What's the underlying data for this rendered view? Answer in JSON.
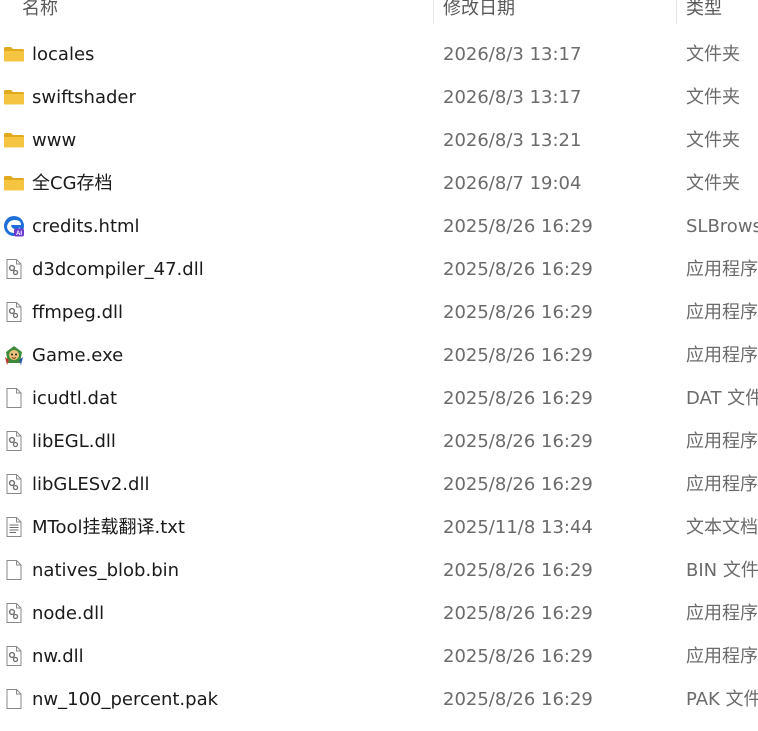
{
  "columns": {
    "name": "名称",
    "date": "修改日期",
    "type": "类型"
  },
  "files": [
    {
      "name": "locales",
      "date": "2026/8/3 13:17",
      "type": "文件夹",
      "icon": "folder-icon"
    },
    {
      "name": "swiftshader",
      "date": "2026/8/3 13:17",
      "type": "文件夹",
      "icon": "folder-icon"
    },
    {
      "name": "www",
      "date": "2026/8/3 13:21",
      "type": "文件夹",
      "icon": "folder-icon"
    },
    {
      "name": "全CG存档",
      "date": "2026/8/7 19:04",
      "type": "文件夹",
      "icon": "folder-icon"
    },
    {
      "name": "credits.html",
      "date": "2025/8/26 16:29",
      "type": "SLBrowser",
      "icon": "browser-html-icon"
    },
    {
      "name": "d3dcompiler_47.dll",
      "date": "2025/8/26 16:29",
      "type": "应用程序扩展",
      "icon": "dll-gear-icon"
    },
    {
      "name": "ffmpeg.dll",
      "date": "2025/8/26 16:29",
      "type": "应用程序扩展",
      "icon": "dll-gear-icon"
    },
    {
      "name": "Game.exe",
      "date": "2025/8/26 16:29",
      "type": "应用程序",
      "icon": "game-exe-icon"
    },
    {
      "name": "icudtl.dat",
      "date": "2025/8/26 16:29",
      "type": "DAT 文件",
      "icon": "blank-file-icon"
    },
    {
      "name": "libEGL.dll",
      "date": "2025/8/26 16:29",
      "type": "应用程序扩展",
      "icon": "dll-gear-icon"
    },
    {
      "name": "libGLESv2.dll",
      "date": "2025/8/26 16:29",
      "type": "应用程序扩展",
      "icon": "dll-gear-icon"
    },
    {
      "name": "MTool挂载翻译.txt",
      "date": "2025/11/8 13:44",
      "type": "文本文档",
      "icon": "text-file-icon"
    },
    {
      "name": "natives_blob.bin",
      "date": "2025/8/26 16:29",
      "type": "BIN 文件",
      "icon": "blank-file-icon"
    },
    {
      "name": "node.dll",
      "date": "2025/8/26 16:29",
      "type": "应用程序扩展",
      "icon": "dll-gear-icon"
    },
    {
      "name": "nw.dll",
      "date": "2025/8/26 16:29",
      "type": "应用程序扩展",
      "icon": "dll-gear-icon"
    },
    {
      "name": "nw_100_percent.pak",
      "date": "2025/8/26 16:29",
      "type": "PAK 文件",
      "icon": "blank-file-icon"
    }
  ],
  "colors": {
    "folder": "#F5C542",
    "folder_dark": "#E0A91E",
    "browser_blue": "#1E6FD9",
    "browser_purple": "#6B3BD1"
  }
}
